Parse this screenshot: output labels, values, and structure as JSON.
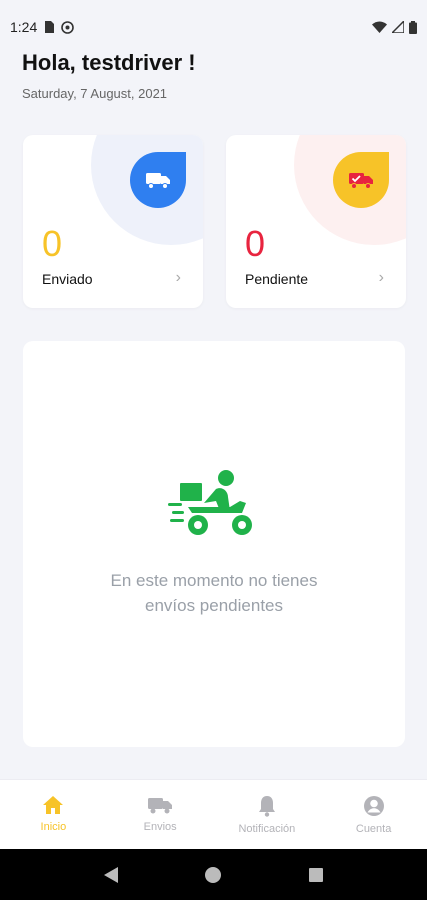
{
  "status_bar": {
    "time": "1:24"
  },
  "header": {
    "greeting": "Hola, testdriver !",
    "date": "Saturday, 7 August, 2021"
  },
  "cards": {
    "sent": {
      "count": "0",
      "label": "Enviado",
      "icon": "truck-icon",
      "color": "#2f7ff0",
      "count_color": "#f7c328"
    },
    "pending": {
      "count": "0",
      "label": "Pendiente",
      "icon": "truck-check-icon",
      "color": "#f7c328",
      "count_color": "#e8243f"
    }
  },
  "empty_state": {
    "illustration": "delivery-scooter-icon",
    "line1": "En este momento no tienes",
    "line2": "envíos pendientes"
  },
  "bottom_nav": {
    "items": [
      {
        "label": "Inicio",
        "icon": "home-icon",
        "active": true
      },
      {
        "label": "Envios",
        "icon": "truck-icon",
        "active": false
      },
      {
        "label": "Notificación",
        "icon": "bell-icon",
        "active": false
      },
      {
        "label": "Cuenta",
        "icon": "account-icon",
        "active": false
      }
    ]
  },
  "colors": {
    "accent": "#f7c328",
    "blue": "#2f7ff0",
    "red": "#e8243f",
    "green": "#20b24a"
  }
}
